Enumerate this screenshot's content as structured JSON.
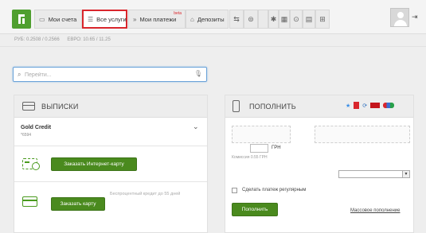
{
  "nav": {
    "items": [
      {
        "label": "Мои счета",
        "icon": "accounts-icon"
      },
      {
        "label": "Все услуги",
        "icon": "menu-icon"
      },
      {
        "label": "Мои платежи",
        "icon": "payments-icon",
        "badge": "beta"
      },
      {
        "label": "Депозиты",
        "icon": "deposit-icon"
      }
    ],
    "icons": [
      "transfer-icon",
      "currency-exchange-icon",
      "apple-icon",
      "android-icon",
      "windows-icon",
      "help-icon",
      "archive-icon",
      "cart-icon"
    ],
    "active": "Все услуги"
  },
  "rates": {
    "usd": "РУБ: 0.2508 / 0.2566",
    "eur": "ЕВРО: 10.65 / 11.25"
  },
  "search": {
    "placeholder": "Перейти..."
  },
  "statements": {
    "title": "ВЫПИСКИ",
    "card_name": "Gold Credit",
    "card_number": "*6594",
    "order_internet_card": "Заказать Интернет-карту",
    "order_card": "Заказать карту",
    "promo": "Беспроцентный кредит до 55 дней"
  },
  "topup": {
    "title": "ПОПОЛНИТЬ",
    "currency": "ГРН",
    "commission": "Комиссия 0.55 ГРН",
    "recurring_label": "Сделать платеж регулярным",
    "submit": "Пополнить",
    "mass_link": "Массовое пополнение"
  },
  "colors": {
    "brand_green": "#4a8a1e",
    "highlight_red": "#d9262c",
    "focus_blue": "#6aa2d8"
  }
}
